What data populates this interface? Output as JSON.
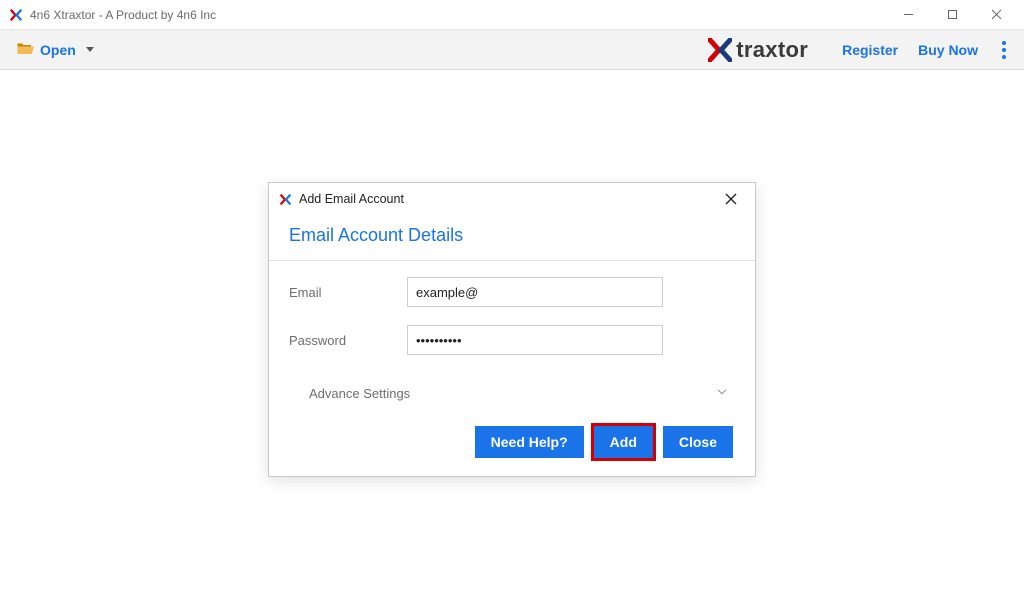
{
  "titlebar": {
    "title": "4n6 Xtraxtor - A Product by 4n6 Inc"
  },
  "toolbar": {
    "open_label": "Open",
    "brand_text": "traxtor",
    "register_label": "Register",
    "buy_now_label": "Buy Now"
  },
  "modal": {
    "header_title": "Add Email Account",
    "section_title": "Email Account Details",
    "email_label": "Email",
    "email_value": "example@",
    "password_label": "Password",
    "password_value": "••••••••••",
    "advance_label": "Advance Settings",
    "need_help_label": "Need Help?",
    "add_label": "Add",
    "close_label": "Close"
  }
}
